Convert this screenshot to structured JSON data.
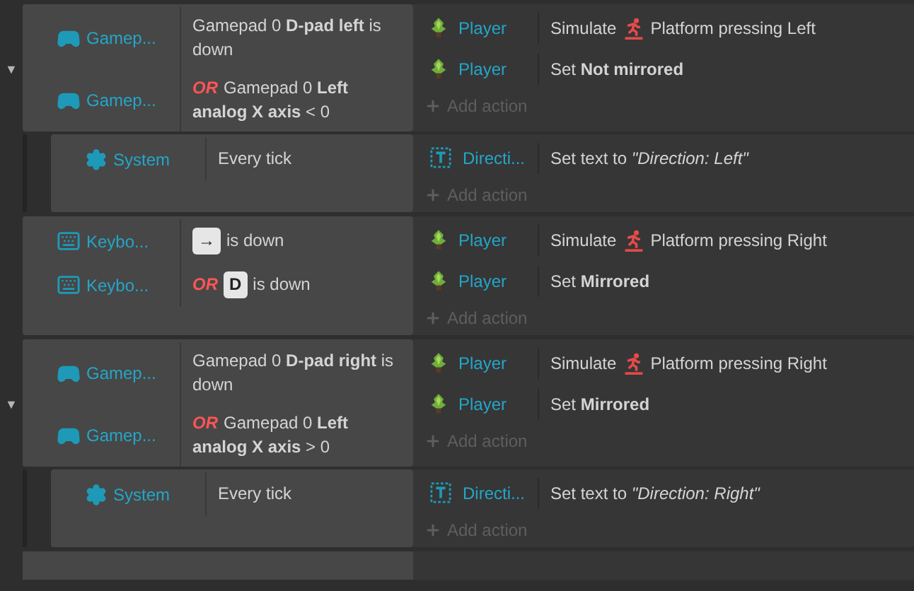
{
  "events": [
    {
      "toggle": "▼",
      "conditions": [
        {
          "kind": "gamepad",
          "object": "Gamep...",
          "text": "Gamepad 0 **D-pad left** is down"
        },
        {
          "kind": "gamepad",
          "object": "Gamep...",
          "or": "OR",
          "text": "Gamepad 0 **Left analog X axis** < 0"
        }
      ],
      "actions": [
        {
          "kind": "simulate",
          "object": "Player",
          "text": "Simulate",
          "text2": "Platform pressing Left"
        },
        {
          "kind": "set",
          "object": "Player",
          "text": "Set **Not mirrored**"
        }
      ],
      "add_action": "Add action",
      "sub_events": [
        {
          "conditions": [
            {
              "kind": "system",
              "object": "System",
              "text": "Every tick"
            }
          ],
          "actions": [
            {
              "kind": "settext",
              "object": "Directi...",
              "text": "Set text to *\"Direction: Left\"*"
            }
          ],
          "add_action": "Add action"
        }
      ]
    },
    {
      "conditions": [
        {
          "kind": "keyboard",
          "object": "Keybo...",
          "key": "→",
          "text": "is down"
        },
        {
          "kind": "keyboard",
          "object": "Keybo...",
          "or": "OR",
          "key": "D",
          "text": "is down"
        }
      ],
      "actions": [
        {
          "kind": "simulate",
          "object": "Player",
          "text": "Simulate",
          "text2": "Platform pressing Right"
        },
        {
          "kind": "set",
          "object": "Player",
          "text": "Set **Mirrored**"
        }
      ],
      "add_action": "Add action"
    },
    {
      "toggle": "▼",
      "conditions": [
        {
          "kind": "gamepad",
          "object": "Gamep...",
          "text": "Gamepad 0 **D-pad right** is down"
        },
        {
          "kind": "gamepad",
          "object": "Gamep...",
          "or": "OR",
          "text": "Gamepad 0 **Left analog X axis** > 0"
        }
      ],
      "actions": [
        {
          "kind": "simulate",
          "object": "Player",
          "text": "Simulate",
          "text2": "Platform pressing Right"
        },
        {
          "kind": "set",
          "object": "Player",
          "text": "Set **Mirrored**"
        }
      ],
      "add_action": "Add action",
      "sub_events": [
        {
          "conditions": [
            {
              "kind": "system",
              "object": "System",
              "text": "Every tick"
            }
          ],
          "actions": [
            {
              "kind": "settext",
              "object": "Directi...",
              "text": "Set text to *\"Direction: Right\"*"
            }
          ],
          "add_action": "Add action"
        }
      ]
    }
  ]
}
